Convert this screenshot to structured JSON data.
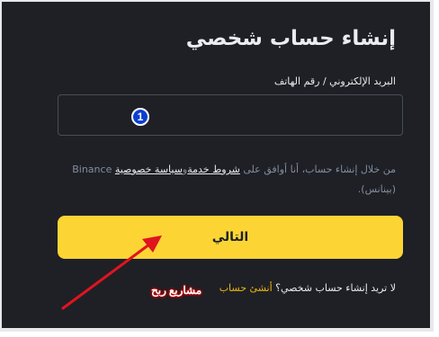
{
  "page": {
    "title": "إنشاء حساب شخصي",
    "field_label": "البريد الإلكتروني / رقم الهاتف",
    "input_value": "",
    "step_badge": "1",
    "terms_prefix": "من خلال إنشاء حساب، أنا أوافق على",
    "terms_link": "شروط خدمة",
    "terms_and": "و",
    "privacy_link": "سياسة خصوصية",
    "terms_suffix": "Binance (بينانس).",
    "next_button": "التالي",
    "footer_text": "لا تريد إنشاء حساب شخصي؟",
    "footer_link": "أنشئ حساب",
    "watermark": "مشاريع ربح"
  },
  "colors": {
    "background": "#1e2026",
    "accent": "#fcd535",
    "link": "#f0b90b",
    "annotation_arrow": "#e0141e",
    "annotation_badge": "#0b3fcf"
  }
}
